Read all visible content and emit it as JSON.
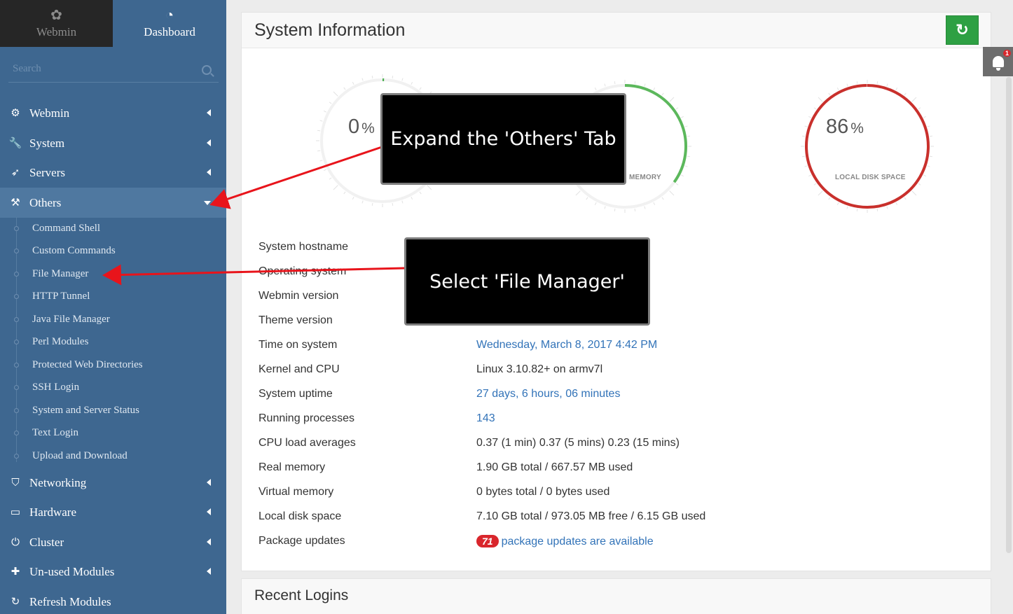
{
  "sidebar": {
    "tabs": [
      {
        "label": "Webmin",
        "icon": "webmin-logo-icon"
      },
      {
        "label": "Dashboard",
        "icon": "dashboard-gauge-icon"
      }
    ],
    "search_placeholder": "Search",
    "menu": [
      {
        "label": "Webmin",
        "icon": "gear-icon"
      },
      {
        "label": "System",
        "icon": "wrench-icon"
      },
      {
        "label": "Servers",
        "icon": "rocket-icon"
      },
      {
        "label": "Others",
        "icon": "gavel-icon"
      },
      {
        "label": "Networking",
        "icon": "shield-icon"
      },
      {
        "label": "Hardware",
        "icon": "hdd-icon"
      },
      {
        "label": "Cluster",
        "icon": "power-icon"
      },
      {
        "label": "Un-used Modules",
        "icon": "puzzle-icon"
      },
      {
        "label": "Refresh Modules",
        "icon": "refresh-icon"
      }
    ],
    "others_items": [
      "Command Shell",
      "Custom Commands",
      "File Manager",
      "HTTP Tunnel",
      "Java File Manager",
      "Perl Modules",
      "Protected Web Directories",
      "SSH Login",
      "System and Server Status",
      "Text Login",
      "Upload and Download"
    ]
  },
  "main": {
    "title": "System Information",
    "gauges": [
      {
        "value": "0",
        "unit": "%",
        "label": "",
        "percent": 0,
        "color": "#4caf50"
      },
      {
        "value": "",
        "unit": "",
        "label": "MEMORY",
        "percent": 35,
        "color": "#5cb85c"
      },
      {
        "value": "86",
        "unit": "%",
        "label": "LOCAL DISK SPACE",
        "percent": 100,
        "color": "#c9302c"
      }
    ],
    "info": [
      {
        "key": "System hostname",
        "value": "",
        "link": false
      },
      {
        "key": "Operating system",
        "value": "",
        "link": false
      },
      {
        "key": "Webmin version",
        "value": "",
        "link": false
      },
      {
        "key": "Theme version",
        "value": "",
        "link": false
      },
      {
        "key": "Time on system",
        "value": "Wednesday, March 8, 2017 4:42 PM",
        "link": true
      },
      {
        "key": "Kernel and CPU",
        "value": "Linux 3.10.82+ on armv7l",
        "link": false
      },
      {
        "key": "System uptime",
        "value": "27 days, 6 hours, 06 minutes",
        "link": true
      },
      {
        "key": "Running processes",
        "value": "143",
        "link": true
      },
      {
        "key": "CPU load averages",
        "value": "0.37 (1 min) 0.37 (5 mins) 0.23 (15 mins)",
        "link": false
      },
      {
        "key": "Real memory",
        "value": "1.90 GB total / 667.57 MB used",
        "link": false
      },
      {
        "key": "Virtual memory",
        "value": "0 bytes total / 0 bytes used",
        "link": false
      },
      {
        "key": "Local disk space",
        "value": "7.10 GB total / 973.05 MB free / 6.15 GB used",
        "link": false
      },
      {
        "key": "Package updates",
        "value": "package updates are available",
        "badge": "71",
        "link": true
      }
    ],
    "recent_title": "Recent Logins"
  },
  "notifications": {
    "count": "1"
  },
  "annotations": {
    "callout_1": "Expand the 'Others' Tab",
    "callout_2": "Select 'File Manager'",
    "arrow_color": "#e8141b"
  }
}
